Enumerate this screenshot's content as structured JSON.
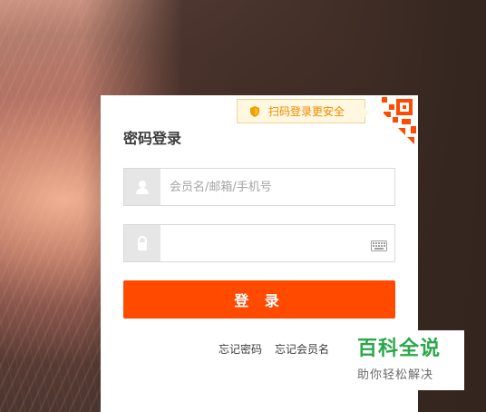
{
  "login": {
    "title": "密码登录",
    "qr_tip": "扫码登录更安全",
    "username_placeholder": "会员名/邮箱/手机号",
    "password_placeholder": "",
    "submit_label": "登 录",
    "links": [
      "忘记密码",
      "忘记会员名"
    ]
  },
  "watermark": {
    "top": "百科全说",
    "bottom": "助你轻松解决"
  },
  "colors": {
    "primary": "#ff4a00",
    "qr_tip_text": "#f08a00",
    "qr_tip_bg": "#fff7df",
    "qr_tip_border": "#f2d38e",
    "watermark_green": "#2aa84a"
  },
  "icons": {
    "shield": "shield-icon",
    "user": "user-icon",
    "lock": "lock-icon",
    "keyboard": "keyboard-icon",
    "qr": "qr-code-icon"
  }
}
